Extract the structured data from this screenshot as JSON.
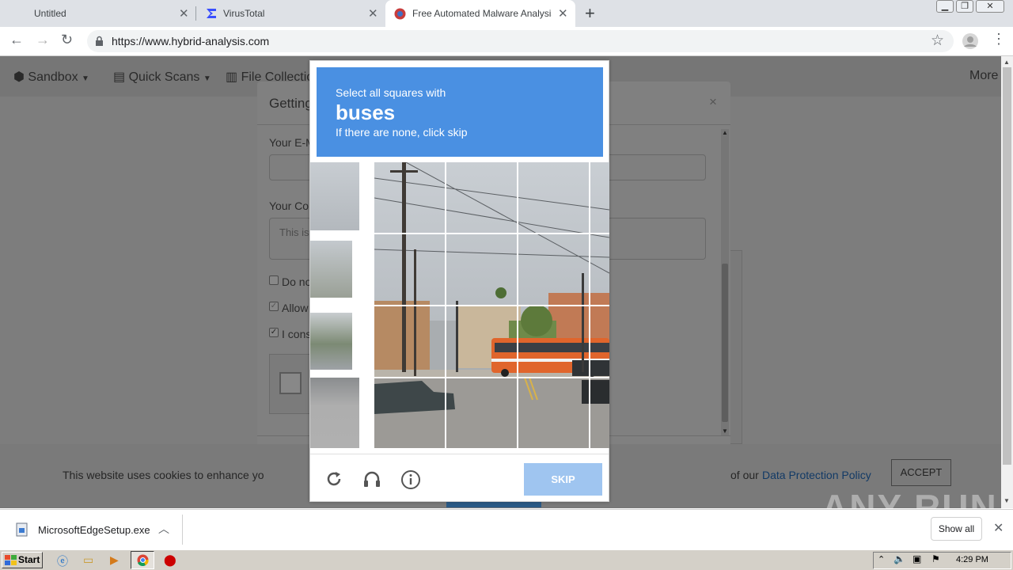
{
  "browser": {
    "tabs": [
      {
        "label": "Untitled",
        "icon": "blank-page-icon"
      },
      {
        "label": "VirusTotal",
        "icon": "virustotal-sigma-icon"
      },
      {
        "label": "Free Automated Malware Analysis Sc",
        "icon": "hybrid-analysis-icon"
      }
    ],
    "new_tab_symbol": "+",
    "url": "https://www.hybrid-analysis.com"
  },
  "site_nav": {
    "sandbox": "Sandbox",
    "quick_scans": "Quick Scans",
    "file_collections": "File Collection",
    "more": "More"
  },
  "modal": {
    "title": "Getting",
    "email_label": "Your E-M",
    "comment_label": "Your Cor",
    "comment_placeholder": "This is",
    "checkbox1": "Do no",
    "checkbox2": "Allow",
    "checkbox3": "I cons",
    "close_symbol": "×"
  },
  "cookie": {
    "text": "This website uses cookies to enhance yo",
    "suffix": "of our",
    "link": "Data Protection Policy",
    "accept": "ACCEPT"
  },
  "captcha": {
    "instruction": "Select all squares with",
    "target": "buses",
    "hint": "If there are none, click skip",
    "skip": "SKIP",
    "colors": {
      "header": "#4a90e2",
      "skip": "#9fc5f0"
    }
  },
  "watermark": "ANY RUN",
  "downloads": {
    "file": "MicrosoftEdgeSetup.exe",
    "show_all": "Show all"
  },
  "taskbar": {
    "start": "Start",
    "clock": "4:29 PM"
  }
}
